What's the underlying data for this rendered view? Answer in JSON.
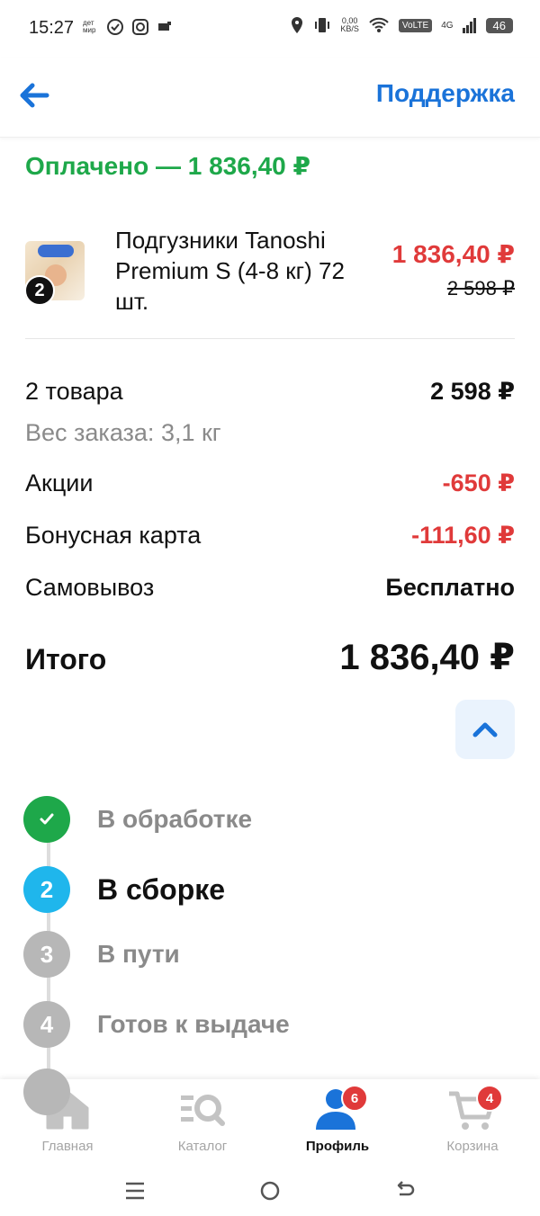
{
  "status_bar": {
    "time": "15:27",
    "mini_text": "дет мир",
    "speed_value": "0,00",
    "speed_unit": "KB/S",
    "volte": "VoLTE",
    "network": "4G",
    "battery": "46"
  },
  "header": {
    "support_label": "Поддержка"
  },
  "order": {
    "status_title": "Оплачено — 1 836,40 ₽"
  },
  "product": {
    "name": "Подгузники Tanoshi Premium S (4-8 кг) 72 шт.",
    "quantity": "2",
    "price": "1 836,40 ₽",
    "old_price": "2 598 ₽"
  },
  "summary": {
    "items_label": "2 товара",
    "items_value": "2 598 ₽",
    "weight_label": "Вес заказа: 3,1 кг",
    "promo_label": "Акции",
    "promo_value": "-650 ₽",
    "bonus_label": "Бонусная карта",
    "bonus_value": "-111,60 ₽",
    "pickup_label": "Самовывоз",
    "pickup_value": "Бесплатно",
    "total_label": "Итого",
    "total_value": "1 836,40 ₽"
  },
  "steps": [
    {
      "number": "",
      "label": "В обработке",
      "state": "done"
    },
    {
      "number": "2",
      "label": "В сборке",
      "state": "active"
    },
    {
      "number": "3",
      "label": "В пути",
      "state": "pending"
    },
    {
      "number": "4",
      "label": "Готов к выдаче",
      "state": "pending"
    }
  ],
  "bottom_nav": {
    "home": "Главная",
    "catalog": "Каталог",
    "profile": "Профиль",
    "profile_badge": "6",
    "cart": "Корзина",
    "cart_badge": "4"
  },
  "colors": {
    "accent_blue": "#1a73d9",
    "success_green": "#1ea84a",
    "price_red": "#e03a3a",
    "active_step": "#1fb6ec",
    "pending_grey": "#b7b7b7"
  },
  "icons": {
    "back": "arrow-left-icon",
    "collapse": "chevron-up-icon",
    "home": "home-icon",
    "catalog": "catalog-search-icon",
    "profile": "profile-icon",
    "cart": "cart-icon"
  }
}
